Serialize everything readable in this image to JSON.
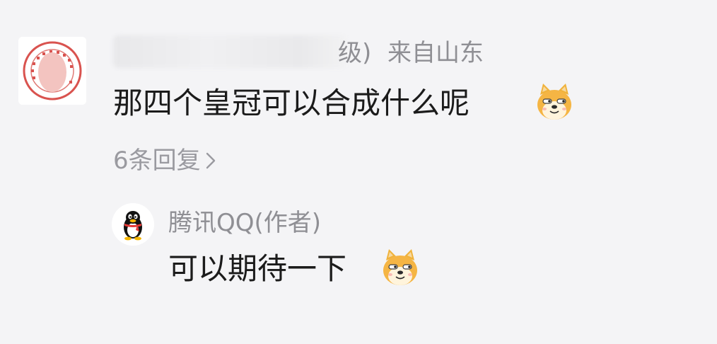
{
  "comment": {
    "author_suffix": "级)",
    "location": "来自山东",
    "text": "那四个皇冠可以合成什么呢",
    "emoji_icon": "doge-emoji",
    "replies_label": "6条回复"
  },
  "reply": {
    "author": "腾讯QQ(作者)",
    "text": "可以期待一下",
    "emoji_icon": "doge-emoji"
  },
  "colors": {
    "background": "#f4f4f6",
    "muted_text": "#8f8f94",
    "main_text": "#1b1b1b",
    "seal_red": "#d9534f"
  }
}
